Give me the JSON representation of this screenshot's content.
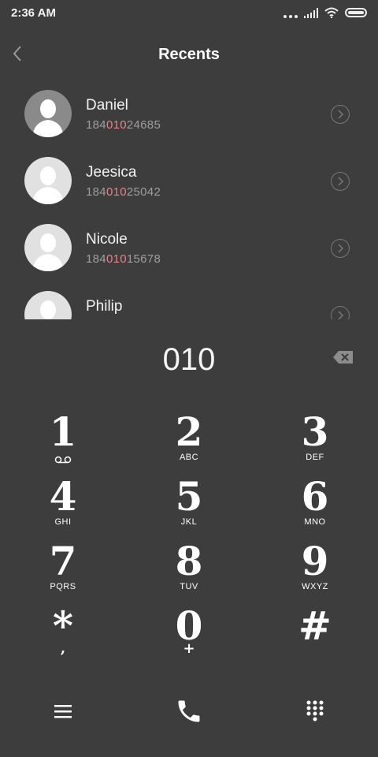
{
  "status_bar": {
    "time": "2:36 AM"
  },
  "header": {
    "title": "Recents"
  },
  "recents": [
    {
      "name": "Daniel",
      "number_prefix": "184",
      "number_match": "010",
      "number_suffix": "24685",
      "avatar": "dim"
    },
    {
      "name": "Jeesica",
      "number_prefix": "184",
      "number_match": "010",
      "number_suffix": "25042",
      "avatar": "light"
    },
    {
      "name": "Nicole",
      "number_prefix": "184",
      "number_match": "010",
      "number_suffix": "15678",
      "avatar": "light"
    },
    {
      "name": "Philip",
      "number_prefix": "",
      "number_match": "",
      "number_suffix": "",
      "avatar": "light"
    }
  ],
  "dial": {
    "input": "010"
  },
  "keypad": [
    {
      "digit": "1",
      "letters": "",
      "sub_icon": "voicemail-icon"
    },
    {
      "digit": "2",
      "letters": "ABC"
    },
    {
      "digit": "3",
      "letters": "DEF"
    },
    {
      "digit": "4",
      "letters": "GHI"
    },
    {
      "digit": "5",
      "letters": "JKL"
    },
    {
      "digit": "6",
      "letters": "MNO"
    },
    {
      "digit": "7",
      "letters": "PQRS"
    },
    {
      "digit": "8",
      "letters": "TUV"
    },
    {
      "digit": "9",
      "letters": "WXYZ"
    },
    {
      "digit": "*",
      "letters": ",",
      "sub": true
    },
    {
      "digit": "0",
      "letters": "+",
      "sub": true
    },
    {
      "digit": "#",
      "letters": ""
    }
  ],
  "icons": {
    "back": "chevron-left-icon",
    "backspace": "backspace-icon",
    "menu": "menu-icon",
    "call": "phone-icon",
    "dialpad": "dialpad-icon",
    "detail": "chevron-right-circle-icon"
  },
  "colors": {
    "background": "#3d3d3d",
    "highlight": "#e8818b",
    "secondary_text": "#9e9e9e"
  }
}
